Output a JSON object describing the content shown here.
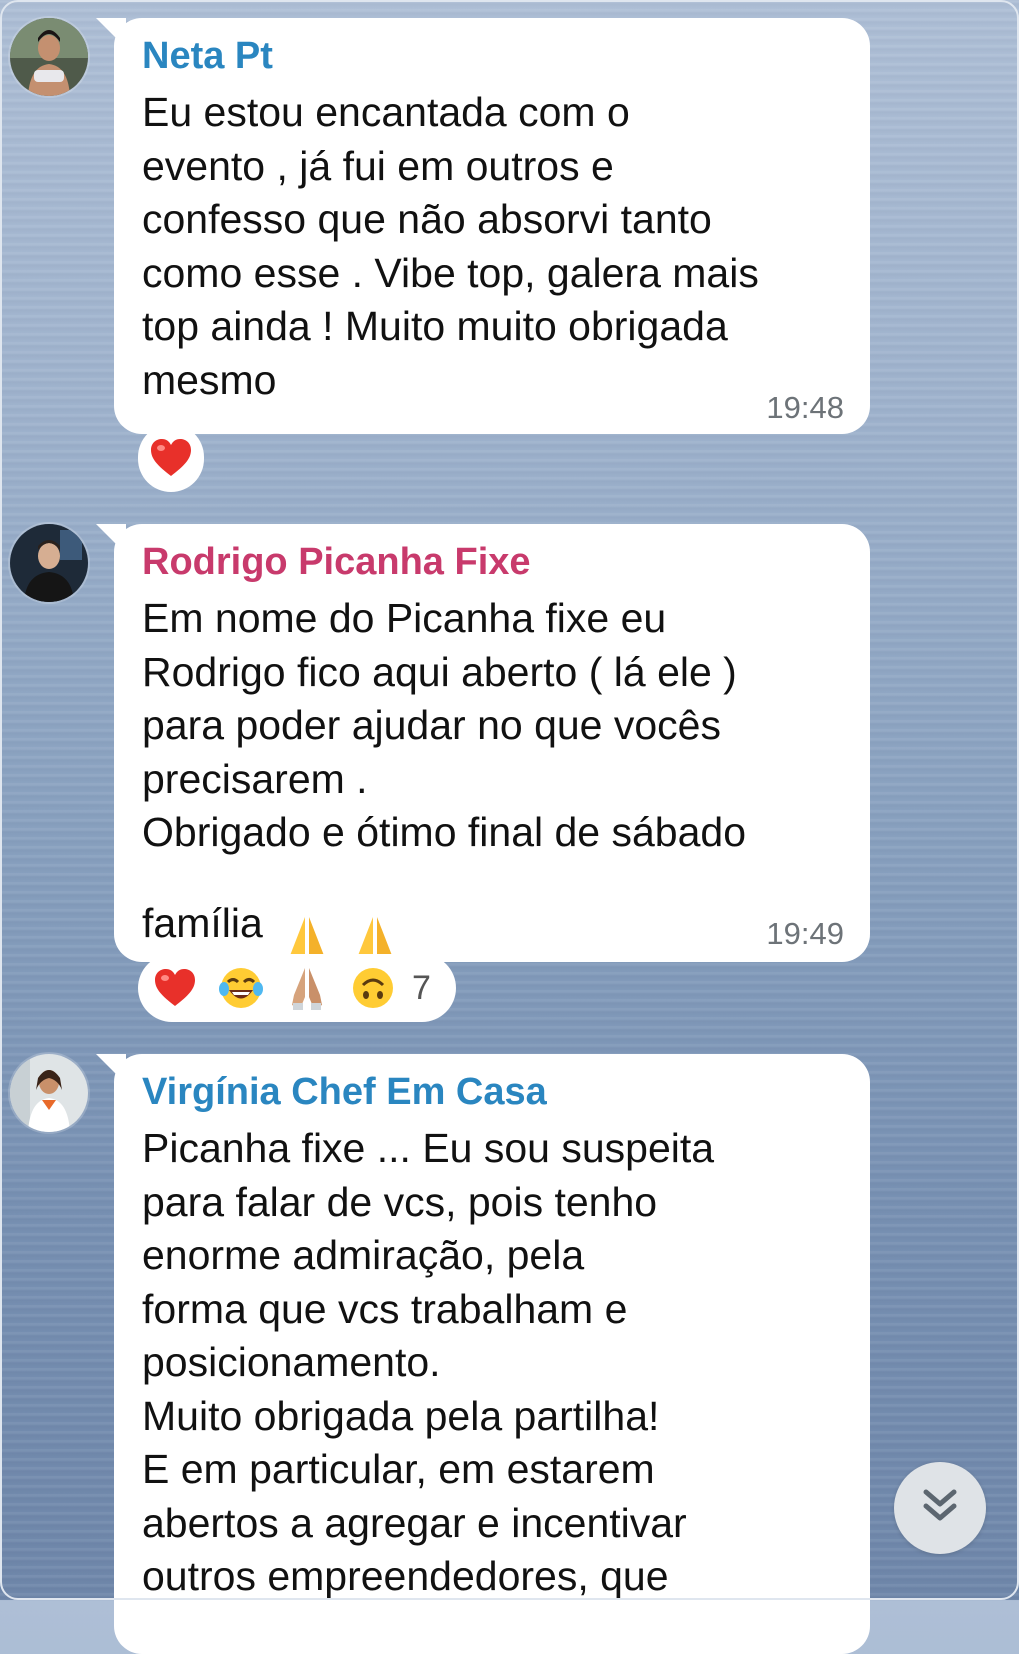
{
  "colors": {
    "name_blue": "#2a86c0",
    "name_pink": "#c83a6c",
    "time": "#6d7378"
  },
  "messages": [
    {
      "sender": "Neta Pt",
      "text": "Eu estou encantada com o\nevento , já fui em outros e\nconfesso que não absorvi tanto\ncomo esse . Vibe top, galera mais\ntop ainda ! Muito muito obrigada\nmesmo",
      "time": "19:48",
      "reactions": [
        "heart"
      ]
    },
    {
      "sender": "Rodrigo Picanha Fixe",
      "text": "Em nome do Picanha fixe eu\nRodrigo fico aqui aberto ( lá ele )\npara poder ajudar no que vocês\nprecisarem .\nObrigado e ótimo final de sábado",
      "text_last_line": "família",
      "time": "19:49",
      "reactions": [
        "heart",
        "tears-of-joy",
        "folded-hands",
        "upside-down-face"
      ],
      "reaction_count": "7"
    },
    {
      "sender": "Virgínia Chef Em Casa",
      "text": "Picanha fixe ... Eu sou suspeita\npara falar de vcs, pois tenho\nenorme admiração, pela\nforma que vcs trabalham e\nposicionamento.\nMuito obrigada pela partilha!\nE em particular, em estarem\nabertos a agregar e incentivar\noutros empreendedores, que"
    }
  ],
  "icons": {
    "scroll_down": "double-chevron-down-icon"
  }
}
